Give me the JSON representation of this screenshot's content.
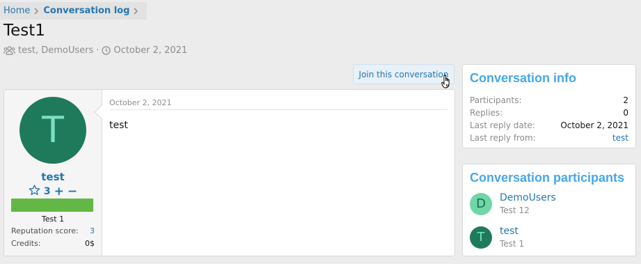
{
  "breadcrumb": {
    "home": "Home",
    "conversation_log": "Conversation log"
  },
  "page": {
    "title": "Test1",
    "participants": "test, DemoUsers",
    "separator": "·",
    "date": "October 2, 2021"
  },
  "actions": {
    "join_label": "Join this conversation"
  },
  "message": {
    "user": {
      "avatar_letter": "T",
      "name": "test",
      "reputation": "3",
      "plus": "+",
      "minus": "−",
      "reputation_fill": 1.0,
      "title": "Test 1",
      "stats": [
        {
          "label": "Reputation score:",
          "value": "3"
        },
        {
          "label": "Credits:",
          "value": "0$"
        }
      ]
    },
    "date": "October 2, 2021",
    "body": "test"
  },
  "info_block": {
    "title": "Conversation info",
    "rows": [
      {
        "label": "Participants:",
        "value": "2"
      },
      {
        "label": "Replies:",
        "value": "0"
      },
      {
        "label": "Last reply date:",
        "value": "October 2, 2021"
      },
      {
        "label": "Last reply from:",
        "value": "test"
      }
    ]
  },
  "participants_block": {
    "title": "Conversation participants",
    "items": [
      {
        "letter": "D",
        "name": "DemoUsers",
        "title": "Test 12",
        "avatar_bg": "#6fd6a6",
        "avatar_fg": "#1f6b4d"
      },
      {
        "letter": "T",
        "name": "test",
        "title": "Test 1",
        "avatar_bg": "#1f7a5b",
        "avatar_fg": "#7ae0c4"
      }
    ]
  },
  "colors": {
    "link": "#2577b1",
    "block_title": "#47a7eb",
    "reputation_bar": "#63b845"
  }
}
